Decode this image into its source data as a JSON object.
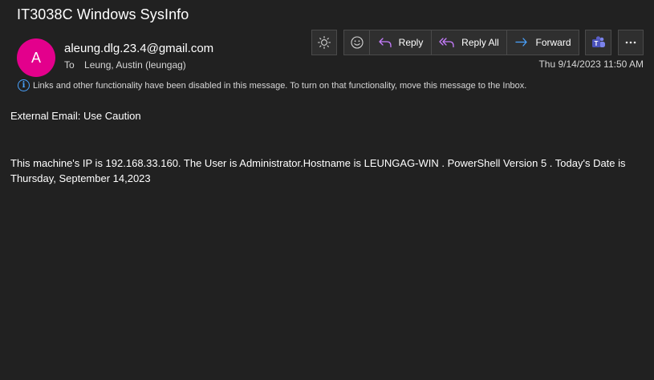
{
  "message": {
    "subject": "IT3038C Windows SysInfo",
    "avatar_initial": "A",
    "avatar_color": "#e3008c",
    "sender": "aleung.dlg.23.4@gmail.com",
    "to_label": "To",
    "to_recipient": "Leung, Austin (leungag)",
    "date": "Thu 9/14/2023 11:50 AM",
    "info_banner": "Links and other functionality have been disabled in this message. To turn on that functionality, move this message to the Inbox.",
    "caution": "External Email: Use Caution",
    "body": "This machine's IP is 192.168.33.160. The User is Administrator.Hostname is LEUNGAG-WIN . PowerShell Version 5 . Today's Date is Thursday, September 14,2023"
  },
  "toolbar": {
    "reply_label": "Reply",
    "reply_all_label": "Reply All",
    "forward_label": "Forward",
    "icons": [
      "brightness-icon",
      "emoji-icon",
      "reply-icon",
      "reply-all-icon",
      "forward-icon",
      "teams-icon",
      "more-icon"
    ],
    "accent_color": "#c77dff",
    "forward_color": "#4aa3ff",
    "teams_color": "#5b5fc7"
  }
}
